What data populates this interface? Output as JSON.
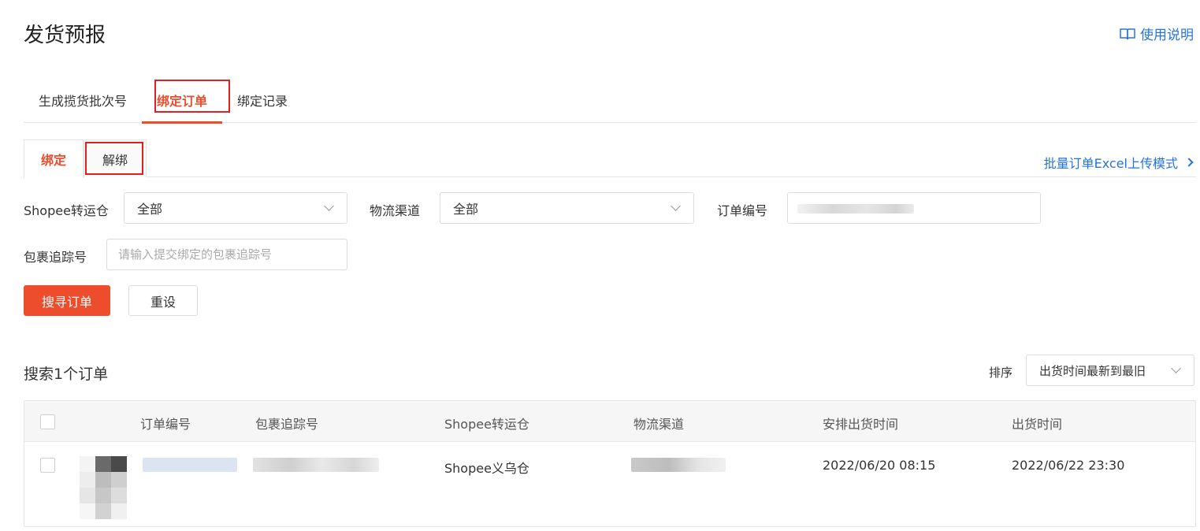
{
  "page": {
    "title": "发货预报",
    "help_link": "使用说明"
  },
  "main_tabs": [
    {
      "label": "生成揽货批次号"
    },
    {
      "label": "绑定订单"
    },
    {
      "label": "绑定记录"
    }
  ],
  "sub_tabs": [
    {
      "label": "绑定"
    },
    {
      "label": "解绑"
    }
  ],
  "excel_link": "批量订单Excel上传模式",
  "filters": {
    "warehouse_label": "Shopee转运仓",
    "warehouse_value": "全部",
    "channel_label": "物流渠道",
    "channel_value": "全部",
    "order_no_label": "订单编号",
    "tracking_label": "包裹追踪号",
    "tracking_placeholder": "请输入提交绑定的包裹追踪号"
  },
  "buttons": {
    "search": "搜寻订单",
    "reset": "重设"
  },
  "results": {
    "count_text": "搜索1个订单",
    "sort_label": "排序",
    "sort_value": "出货时间最新到最旧"
  },
  "table": {
    "headers": [
      "订单编号",
      "包裹追踪号",
      "Shopee转运仓",
      "物流渠道",
      "安排出货时间",
      "出货时间"
    ],
    "rows": [
      {
        "warehouse": "Shopee义乌仓",
        "arrange_time": "2022/06/20 08:15",
        "ship_time": "2022/06/22 23:30"
      }
    ]
  },
  "colors": {
    "accent": "#ee4d2d",
    "link": "#2673dd",
    "highlight": "#e02020"
  },
  "icons": {
    "help": "book-icon",
    "excel_link": "chevron-right-icon",
    "select": "chevron-down-icon"
  }
}
